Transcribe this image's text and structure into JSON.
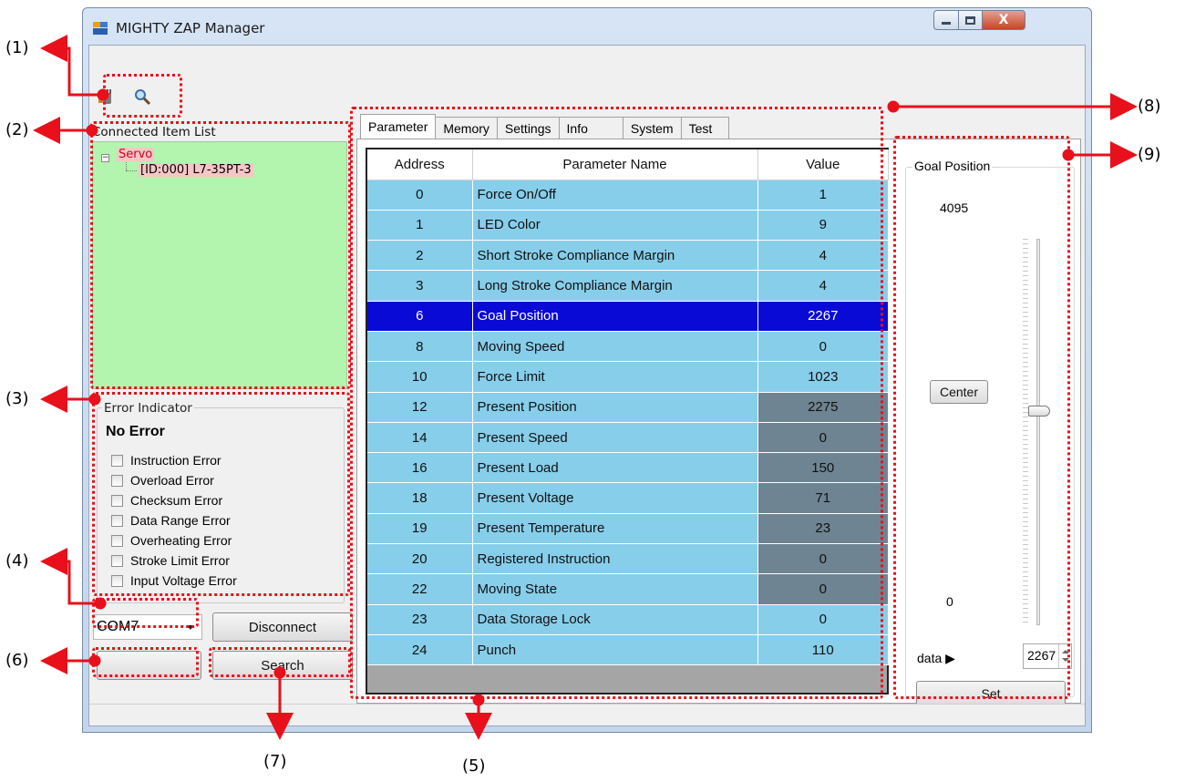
{
  "window": {
    "title": "MIGHTY ZAP Manager",
    "close_glyph": "X"
  },
  "panels": {
    "connected_list_label": "Connected Item List",
    "tree": {
      "expander": "−",
      "root": "Servo",
      "child": "[ID:000] L7-35PT-3"
    }
  },
  "error_indicator": {
    "title": "Error Indicator",
    "status": "No Error",
    "items": [
      "Instruction Error",
      "Overload Error",
      "Checksum Error",
      "Data Range Error",
      "Overheating Error",
      "Stroke Limit Error",
      "Input Voltage Error"
    ]
  },
  "connection": {
    "port": "COM7",
    "disconnect_label": "Disconnect",
    "blank_label": "",
    "search_label": "Search"
  },
  "tabs": [
    "Parameter",
    "Memory",
    "Settings",
    "Info",
    "System",
    "Test"
  ],
  "grid": {
    "headers": [
      "Address",
      "Parameter Name",
      "Value"
    ],
    "rows": [
      {
        "addr": "0",
        "name": "Force On/Off",
        "value": "1",
        "readonly": false
      },
      {
        "addr": "1",
        "name": "LED Color",
        "value": "9",
        "readonly": false
      },
      {
        "addr": "2",
        "name": "Short Stroke Compliance Margin",
        "value": "4",
        "readonly": false
      },
      {
        "addr": "3",
        "name": "Long Stroke Compliance Margin",
        "value": "4",
        "readonly": false
      },
      {
        "addr": "6",
        "name": "Goal Position",
        "value": "2267",
        "readonly": false,
        "selected": true
      },
      {
        "addr": "8",
        "name": "Moving Speed",
        "value": "0",
        "readonly": false
      },
      {
        "addr": "10",
        "name": "Force Limit",
        "value": "1023",
        "readonly": false
      },
      {
        "addr": "12",
        "name": "Present Position",
        "value": "2275",
        "readonly": true
      },
      {
        "addr": "14",
        "name": "Present Speed",
        "value": "0",
        "readonly": true
      },
      {
        "addr": "16",
        "name": "Present Load",
        "value": "150",
        "readonly": true
      },
      {
        "addr": "18",
        "name": "Present Voltage",
        "value": "71",
        "readonly": true
      },
      {
        "addr": "19",
        "name": "Present Temperature",
        "value": "23",
        "readonly": true
      },
      {
        "addr": "20",
        "name": "Registered Instruction",
        "value": "0",
        "readonly": true
      },
      {
        "addr": "22",
        "name": "Moving State",
        "value": "0",
        "readonly": true
      },
      {
        "addr": "23",
        "name": "Data Storage Lock",
        "value": "0",
        "readonly": false
      },
      {
        "addr": "24",
        "name": "Punch",
        "value": "110",
        "readonly": false
      }
    ]
  },
  "goal_position": {
    "title": "Goal Position",
    "max": "4095",
    "min": "0",
    "center_label": "Center",
    "data_label": "data ▶",
    "data_value": "2267",
    "set_label": "Set",
    "slider_fraction": 0.554
  },
  "callouts": [
    "(1)",
    "(2)",
    "(3)",
    "(4)",
    "(5)",
    "(6)",
    "(7)",
    "(8)",
    "(9)"
  ],
  "colors": {
    "annotation": "#e8101a",
    "grid_cell": "#87ceeb",
    "grid_readonly": "#6e8492",
    "grid_selected": "#0a0ad6",
    "tree_bg": "#b3f4ae"
  }
}
